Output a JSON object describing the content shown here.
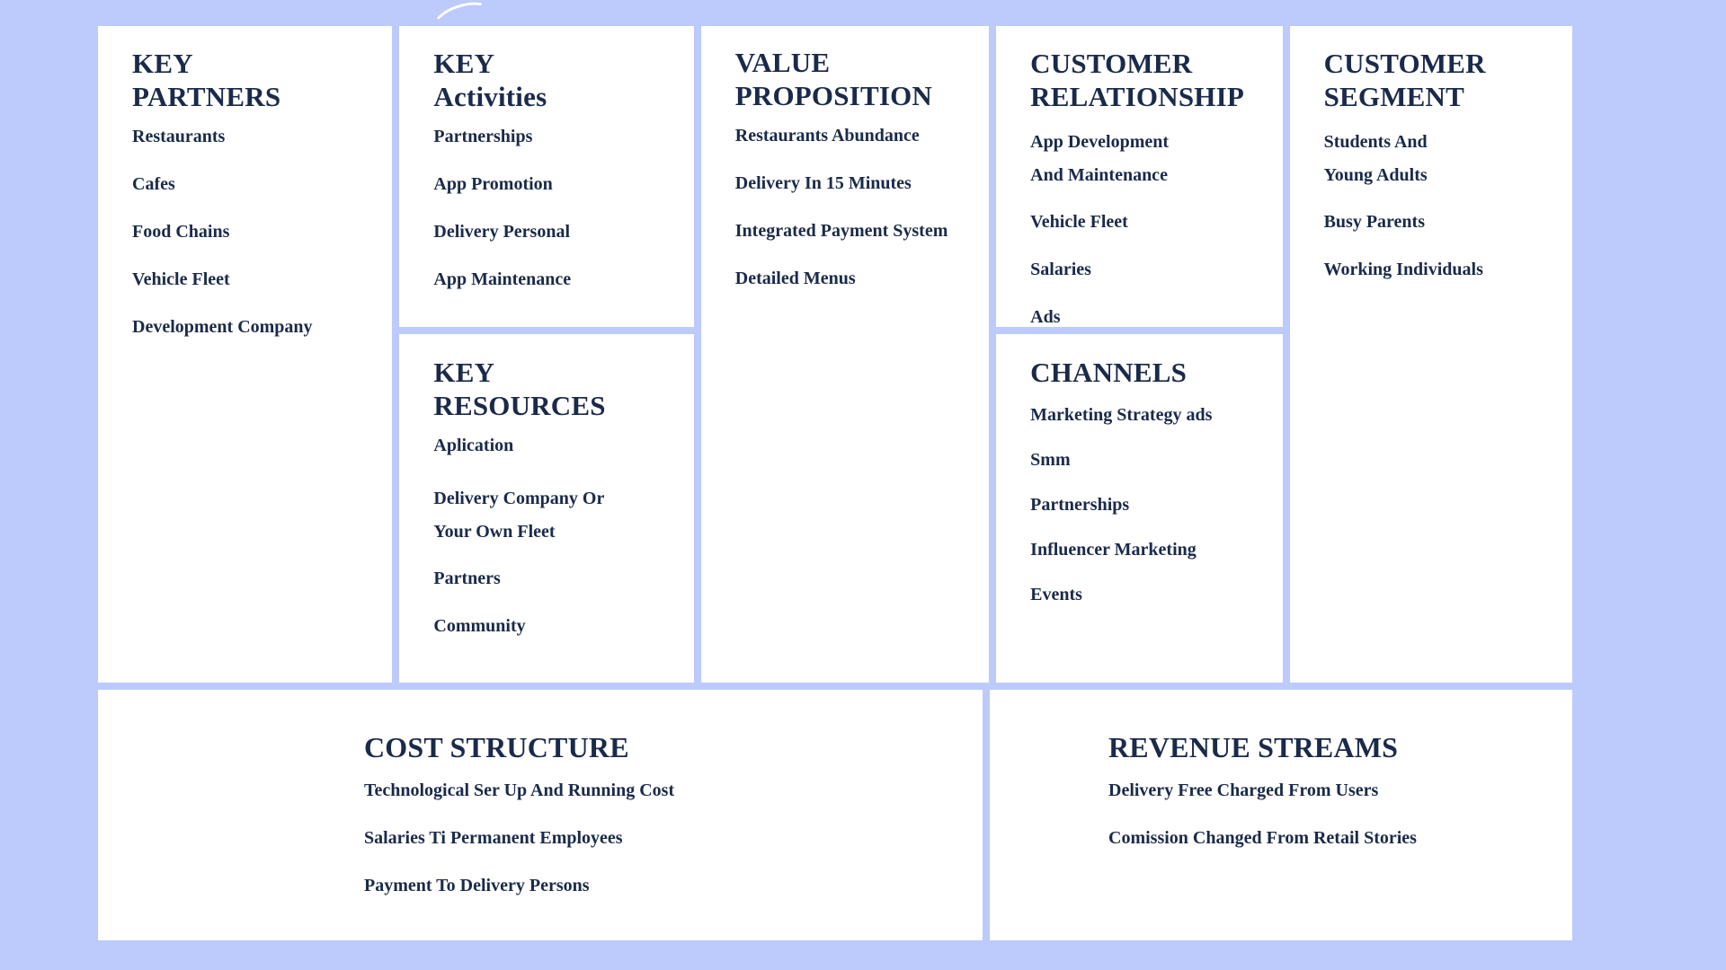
{
  "theme": {
    "background_color": "#bccafc",
    "panel_color": "#ffffff",
    "text_color": "#1a2a4a"
  },
  "canvas": {
    "type": "business-model-canvas",
    "blocks": {
      "key_partners": {
        "title": "KEY\nPARTNERS",
        "items": [
          "Restaurants",
          "Cafes",
          "Food Chains",
          "Vehicle Fleet",
          "Development Company"
        ]
      },
      "key_activities": {
        "title": "KEY\nActivities",
        "items": [
          "Partnerships",
          "App Promotion",
          "Delivery Personal",
          "App Maintenance"
        ]
      },
      "key_resources": {
        "title": "KEY\nRESOURCES",
        "items": [
          "Aplication",
          "Delivery Company Or\nYour Own Fleet",
          "Partners",
          "Community"
        ]
      },
      "value_proposition": {
        "title": "VALUE\nPROPOSITION",
        "items": [
          "Restaurants Abundance",
          "Delivery In 15 Minutes",
          "Integrated Payment System",
          "Detailed Menus"
        ]
      },
      "customer_relationship": {
        "title": "CUSTOMER\nRELATIONSHIP",
        "items": [
          "App Development\nAnd Maintenance",
          "Vehicle Fleet",
          "Salaries",
          "Ads"
        ]
      },
      "channels": {
        "title": "CHANNELS",
        "items": [
          "Marketing Strategy ads",
          "Smm",
          "Partnerships",
          "Influencer Marketing",
          "Events"
        ]
      },
      "customer_segment": {
        "title": "CUSTOMER\nSEGMENT",
        "items": [
          "Students And\nYoung Adults",
          "Busy Parents",
          "Working Individuals"
        ]
      },
      "cost_structure": {
        "title": "COST STRUCTURE",
        "items": [
          "Technological Ser Up And Running Cost",
          "Salaries Ti Permanent Employees",
          "Payment To Delivery Persons"
        ]
      },
      "revenue_streams": {
        "title": "REVENUE STREAMS",
        "items": [
          "Delivery Free Charged From Users",
          "Comission Changed From Retail Stories"
        ]
      }
    }
  }
}
